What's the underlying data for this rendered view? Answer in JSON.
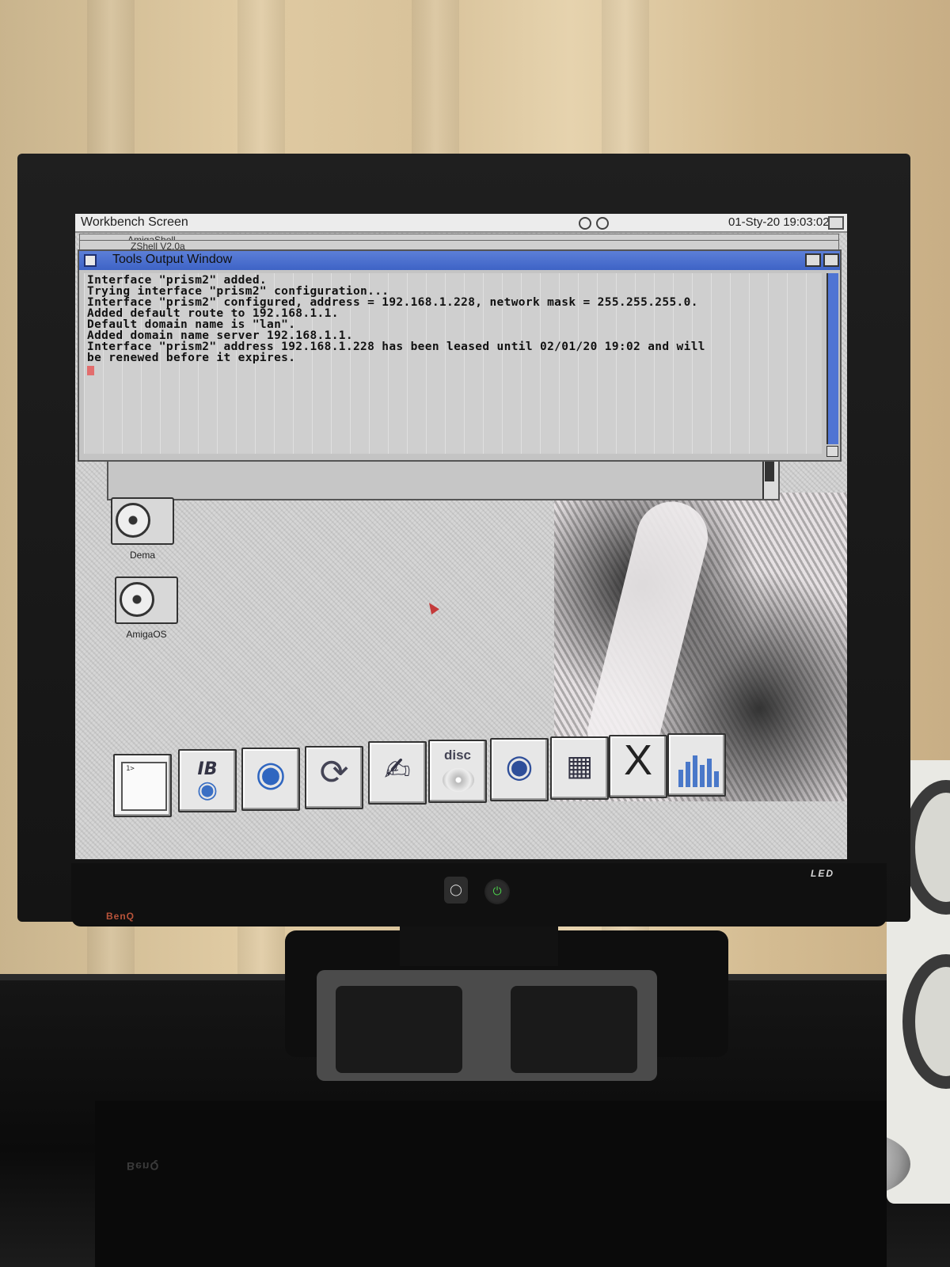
{
  "screen": {
    "title": "Workbench Screen",
    "clock": "01-Sty-20 19:03:02"
  },
  "background_windows": [
    {
      "title": "AmigaShell"
    },
    {
      "title": "ZShell V2.0a"
    }
  ],
  "tools_window": {
    "title": "Tools Output Window",
    "lines": [
      "Interface \"prism2\" added.",
      "Trying interface \"prism2\" configuration...",
      "Interface \"prism2\" configured, address = 192.168.1.228, network mask = 255.255.255.0.",
      "Added default route to 192.168.1.1.",
      "Default domain name is \"lan\".",
      "Added domain name server 192.168.1.1.",
      "Interface \"prism2\" address 192.168.1.228 has been leased until 02/01/20 19:02 and will",
      "be renewed before it expires."
    ]
  },
  "desktop_icons": [
    {
      "label": "Dema",
      "icon": "hard-drive-icon"
    },
    {
      "label": "AmigaOS",
      "icon": "hard-drive-icon"
    }
  ],
  "dock": {
    "items": [
      {
        "name": "shell",
        "icon": "shell-window-icon"
      },
      {
        "name": "ibrowse",
        "icon": "globe-plug-icon",
        "glyph_text": "IB"
      },
      {
        "name": "network",
        "icon": "globe-icon"
      },
      {
        "name": "reload",
        "icon": "reload-icon"
      },
      {
        "name": "editor",
        "icon": "text-editor-icon"
      },
      {
        "name": "disc",
        "icon": "disc-icon",
        "glyph_text": "disc"
      },
      {
        "name": "viewer",
        "icon": "eye-icon"
      },
      {
        "name": "layout",
        "icon": "columns-icon"
      },
      {
        "name": "x",
        "icon": "x-icon",
        "glyph_text": "X"
      },
      {
        "name": "mixer",
        "icon": "equalizer-icon"
      }
    ]
  },
  "monitor": {
    "brand": "BenQ",
    "led_label": "LED",
    "box_brand": "BenQ"
  },
  "colors": {
    "title_bar_active": "#4a6fd0",
    "cursor": "#e26d6d",
    "console_bg": "#cfcfcf"
  }
}
